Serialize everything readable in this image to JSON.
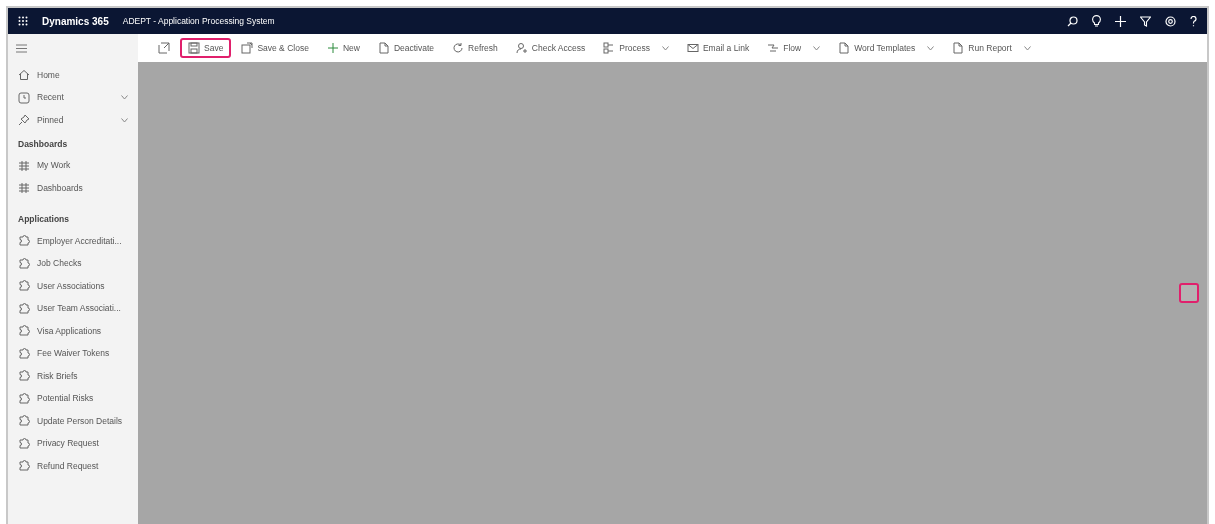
{
  "header": {
    "app_name": "Dynamics 365",
    "title": "ADEPT - Application Processing System"
  },
  "command_bar": [
    {
      "kind": "button",
      "label": "Save",
      "highlighted": true
    },
    {
      "kind": "button",
      "label": "Save & Close",
      "highlighted": false
    },
    {
      "kind": "button",
      "label": "New",
      "highlighted": false
    },
    {
      "kind": "button",
      "label": "Deactivate",
      "highlighted": false
    },
    {
      "kind": "button",
      "label": "Refresh",
      "highlighted": false
    },
    {
      "kind": "button",
      "label": "Check Access",
      "highlighted": false
    },
    {
      "kind": "dropdown",
      "label": "Process",
      "highlighted": false
    },
    {
      "kind": "button",
      "label": "Email a Link",
      "highlighted": false
    },
    {
      "kind": "dropdown",
      "label": "Flow",
      "highlighted": false
    },
    {
      "kind": "dropdown",
      "label": "Word Templates",
      "highlighted": false
    },
    {
      "kind": "dropdown",
      "label": "Run Report",
      "highlighted": false
    }
  ],
  "sidebar": {
    "top_items": [
      {
        "label": "Home",
        "expandable": false
      },
      {
        "label": "Recent",
        "expandable": true
      },
      {
        "label": "Pinned",
        "expandable": true
      }
    ],
    "sections": [
      {
        "heading": "Dashboards",
        "items": [
          {
            "label": "My Work"
          },
          {
            "label": "Dashboards"
          }
        ]
      },
      {
        "heading": "Applications",
        "items": [
          {
            "label": "Employer Accreditati..."
          },
          {
            "label": "Job Checks"
          },
          {
            "label": "User Associations"
          },
          {
            "label": "User Team Associati..."
          },
          {
            "label": "Visa Applications"
          },
          {
            "label": "Fee Waiver Tokens"
          },
          {
            "label": "Risk Briefs"
          },
          {
            "label": "Potential Risks"
          },
          {
            "label": "Update Person Details"
          },
          {
            "label": "Privacy Request"
          },
          {
            "label": "Refund Request"
          }
        ]
      }
    ]
  },
  "side_control": {
    "highlighted": true
  }
}
